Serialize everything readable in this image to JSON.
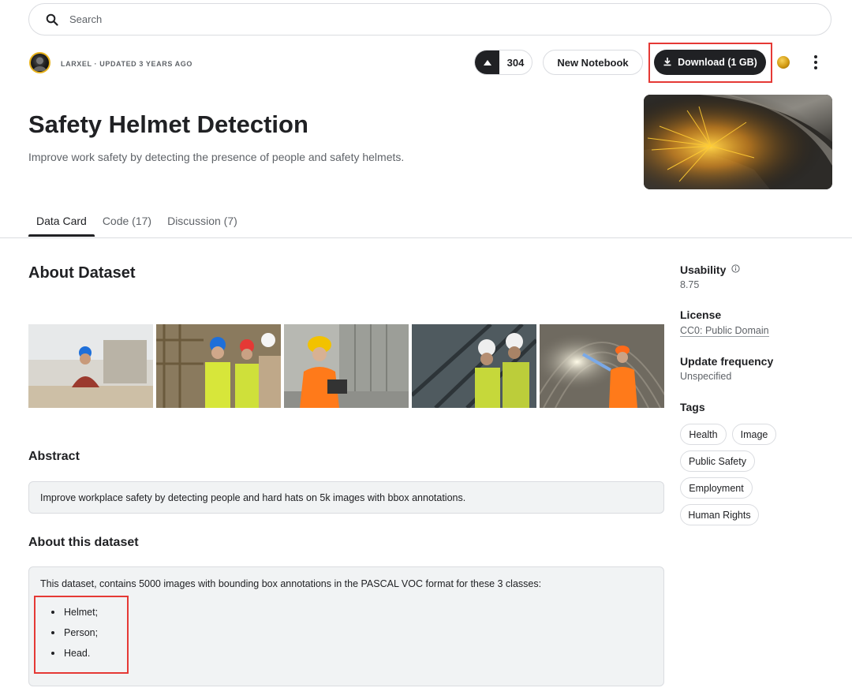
{
  "search": {
    "placeholder": "Search"
  },
  "header": {
    "author_line": "LARXEL · UPDATED 3 YEARS AGO",
    "vote_count": "304",
    "new_notebook_label": "New Notebook",
    "download_label": "Download (1 GB)"
  },
  "dataset": {
    "title": "Safety Helmet Detection",
    "subtitle": "Improve work safety by detecting the presence of people and safety helmets."
  },
  "tabs": [
    {
      "label": "Data Card",
      "active": true
    },
    {
      "label": "Code (17)",
      "active": false
    },
    {
      "label": "Discussion (7)",
      "active": false
    }
  ],
  "about": {
    "heading": "About Dataset",
    "abstract_heading": "Abstract",
    "abstract_text": "Improve workplace safety by detecting people and hard hats on 5k images with bbox annotations.",
    "about_heading": "About this dataset",
    "about_text": "This dataset, contains 5000 images with bounding box annotations in the PASCAL VOC format for these 3 classes:",
    "classes": [
      "Helmet;",
      "Person;",
      "Head."
    ]
  },
  "sidebar": {
    "usability_label": "Usability",
    "usability_value": "8.75",
    "license_label": "License",
    "license_value": "CC0: Public Domain",
    "update_label": "Update frequency",
    "update_value": "Unspecified",
    "tags_label": "Tags",
    "tags": [
      "Health",
      "Image",
      "Public Safety",
      "Employment",
      "Human Rights"
    ]
  },
  "colors": {
    "accent_dark": "#202124",
    "highlight_red": "#e53935",
    "helmet_blue": "#1e6fd9",
    "helmet_yellow": "#f2c200",
    "vest_orange": "#ff7a1a",
    "medal_gold": "#d29a12"
  },
  "icons": {
    "search": "search-icon",
    "upvote": "caret-up-icon",
    "download": "download-icon",
    "medal": "medal-icon",
    "more": "kebab-menu-icon",
    "info": "info-icon"
  }
}
